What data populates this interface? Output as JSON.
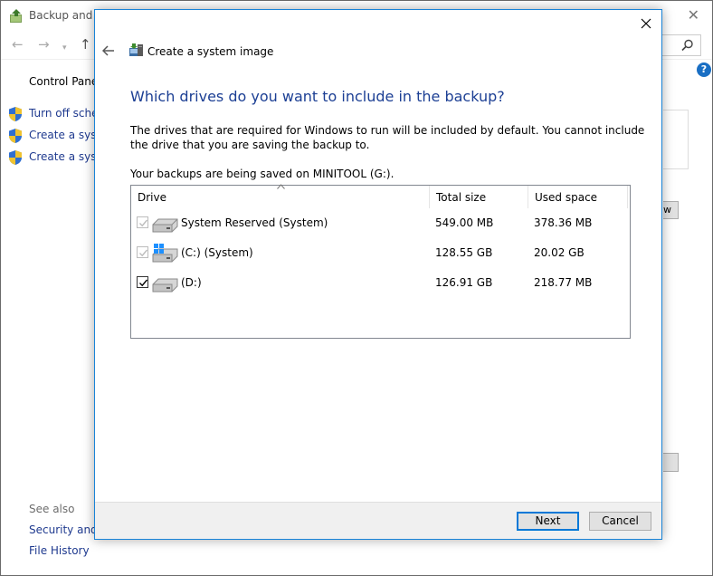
{
  "background_window": {
    "title": "Backup and R",
    "sidebar_title": "Control Panel",
    "tasks": [
      {
        "label": "Turn off sched"
      },
      {
        "label": "Create a syste"
      },
      {
        "label": "Create a syste"
      }
    ],
    "see_also_label": "See also",
    "see_also_links": [
      {
        "label": "Security and M"
      },
      {
        "label": "File History"
      }
    ],
    "partial_button_text": "w",
    "help_symbol": "?"
  },
  "dialog": {
    "header_title": "Create a system image",
    "heading": "Which drives do you want to include in the backup?",
    "description": "The drives that are required for Windows to run will be included by default. You cannot include the drive that you are saving the backup to.",
    "save_location": "Your backups are being saved on MINITOOL (G:).",
    "columns": {
      "drive": "Drive",
      "total_size": "Total size",
      "used_space": "Used space"
    },
    "drives": [
      {
        "name": "System Reserved (System)",
        "total_size": "549.00 MB",
        "used_space": "378.36 MB",
        "checked": true,
        "disabled": true,
        "windows_logo": false
      },
      {
        "name": "(C:) (System)",
        "total_size": "128.55 GB",
        "used_space": "20.02 GB",
        "checked": true,
        "disabled": true,
        "windows_logo": true
      },
      {
        "name": "(D:)",
        "total_size": "126.91 GB",
        "used_space": "218.77 MB",
        "checked": true,
        "disabled": false,
        "windows_logo": false
      }
    ],
    "buttons": {
      "next": "Next",
      "cancel": "Cancel"
    }
  },
  "colors": {
    "heading": "#1c3f94",
    "link": "#1f3a8f",
    "accent": "#0078d7"
  }
}
